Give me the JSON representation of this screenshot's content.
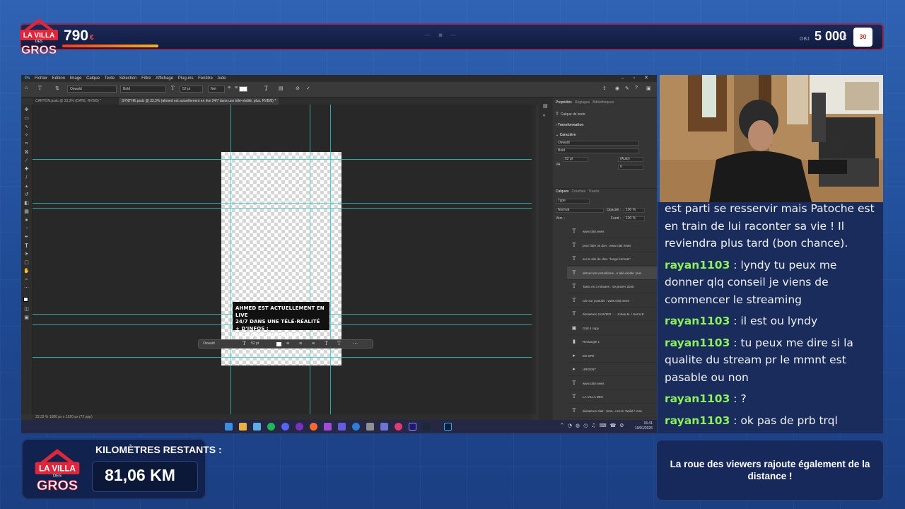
{
  "top_bar": {
    "logo_text": [
      "LA VILLA",
      "DES",
      "GROS"
    ],
    "score": "790",
    "score_unit": "€",
    "progress_fraction": 0.136,
    "right_label": "OBJ.",
    "right_value": "5 000",
    "right_unit": "€",
    "badge_text": "30"
  },
  "photoshop": {
    "menu": [
      "Fichier",
      "Edition",
      "Image",
      "Calque",
      "Texte",
      "Sélection",
      "Filtre",
      "Affichage",
      "Plug-ins",
      "Fenêtre",
      "Aide"
    ],
    "options": {
      "font_family": "Oswald",
      "font_style": "Bold",
      "font_size": "52 pt",
      "antialias": "Net"
    },
    "tabs": [
      "CARTON.psdc @ 33,3% (DATE, RVB/8) *",
      "SYNTHE.psdc @ 33,3% (ahmed est actuellement en live 24/7 dans une télé-réalité. plus, RVB/8) *"
    ],
    "canvas_text": [
      "AHMED EST ACTUELLEMENT EN LIVE",
      "24/7 DANS UNE TÉLÉ-RÉALITÉ",
      "+ D'INFOS : KICK.COM/AHMEDLNDY"
    ],
    "context_bar": {
      "font_family": "Oswald",
      "font_size": "52 pt"
    },
    "status": "33,33 %     1080 px x 1920 px (72 ppp)",
    "panels": {
      "props_tabs": [
        "Propriétés",
        "Réglages",
        "Bibliothèques"
      ],
      "layer_kind": "Calque de texte",
      "transform_label": "Transformation",
      "char_label": "Caractère",
      "char_font": "Oswald",
      "char_style": "Bold",
      "char_size": "52 pt",
      "char_leading": "(Auto)",
      "char_va": "VA",
      "char_tracking": "0",
      "layers_tabs": [
        "Calques",
        "Couches",
        "Tracés"
      ],
      "search_placeholder": "Type",
      "blend_mode": "Normal",
      "opacity_label": "Opacité :",
      "opacity_value": "100 %",
      "lock_label": "Verr. :",
      "fill_label": "Fond :",
      "fill_value": "100 %",
      "layers": [
        {
          "type": "T",
          "name": "www.clair.news",
          "visible": false,
          "selected": false
        },
        {
          "type": "T",
          "name": "pour faire un don : www.clair.news",
          "visible": false,
          "selected": false
        },
        {
          "type": "T",
          "name": "sur le site du clan. \"longs formats\"",
          "visible": false,
          "selected": false
        },
        {
          "type": "T",
          "name": "ahmed est actuelleme...e télé-réalité. plus",
          "visible": true,
          "selected": true
        },
        {
          "type": "T",
          "name": "Tantu en 3 minutes : 19 janvier 2026",
          "visible": false,
          "selected": false
        },
        {
          "type": "T",
          "name": "cdv sur youtube : www.clair.news",
          "visible": false,
          "selected": false
        },
        {
          "type": "T",
          "name": "donateurs JANVIER : ... Johan M. / Sarra B",
          "visible": false,
          "selected": false
        },
        {
          "type": "img",
          "name": "Grid 4 copy",
          "visible": true,
          "selected": false
        },
        {
          "type": "rect",
          "name": "Rectangle 1",
          "visible": true,
          "selected": false
        },
        {
          "type": "folder",
          "name": "ED SPÉ",
          "visible": false,
          "selected": false
        },
        {
          "type": "folder",
          "name": "URGENT",
          "visible": false,
          "selected": false
        },
        {
          "type": "T",
          "name": "www.clair.news",
          "visible": false,
          "selected": false
        },
        {
          "type": "T",
          "name": "LA VILLA DES",
          "visible": true,
          "selected": false
        },
        {
          "type": "T",
          "name": "donateurs clair : Sma...nce B. Walid / Vrac",
          "visible": false,
          "selected": false
        },
        {
          "type": "T",
          "name": "flash urgent : 7 janvier 2026",
          "visible": false,
          "selected": false
        }
      ]
    }
  },
  "taskbar": {
    "time": "15:41",
    "date": "19/01/2026"
  },
  "chat": {
    "intro": "est parti se resservir mais Patoche est en train de lui raconter sa vie ! Il reviendra plus tard (bon chance).",
    "messages": [
      {
        "user": "rayan1103",
        "text": "lyndy tu peux me donner qlq conseil je viens de commencer le streaming"
      },
      {
        "user": "rayan1103",
        "text": "il est ou lyndy"
      },
      {
        "user": "rayan1103",
        "text": "tu peux me dire si la qualite du stream pr le mmnt est pasable ou non"
      },
      {
        "user": "rayan1103",
        "text": "?"
      },
      {
        "user": "rayan1103",
        "text": "ok pas de prb trql"
      }
    ],
    "separator": " : "
  },
  "km_box": {
    "label": "KILOMÈTRES RESTANTS :",
    "value": "81,06 KM"
  },
  "info_box": {
    "text": "La roue des viewers rajoute également de la distance !"
  },
  "colors": {
    "background": "#2a5aa8",
    "accent_red": "#e0263a",
    "chat_user": "#8cf25a",
    "guide": "#37c6c6"
  }
}
